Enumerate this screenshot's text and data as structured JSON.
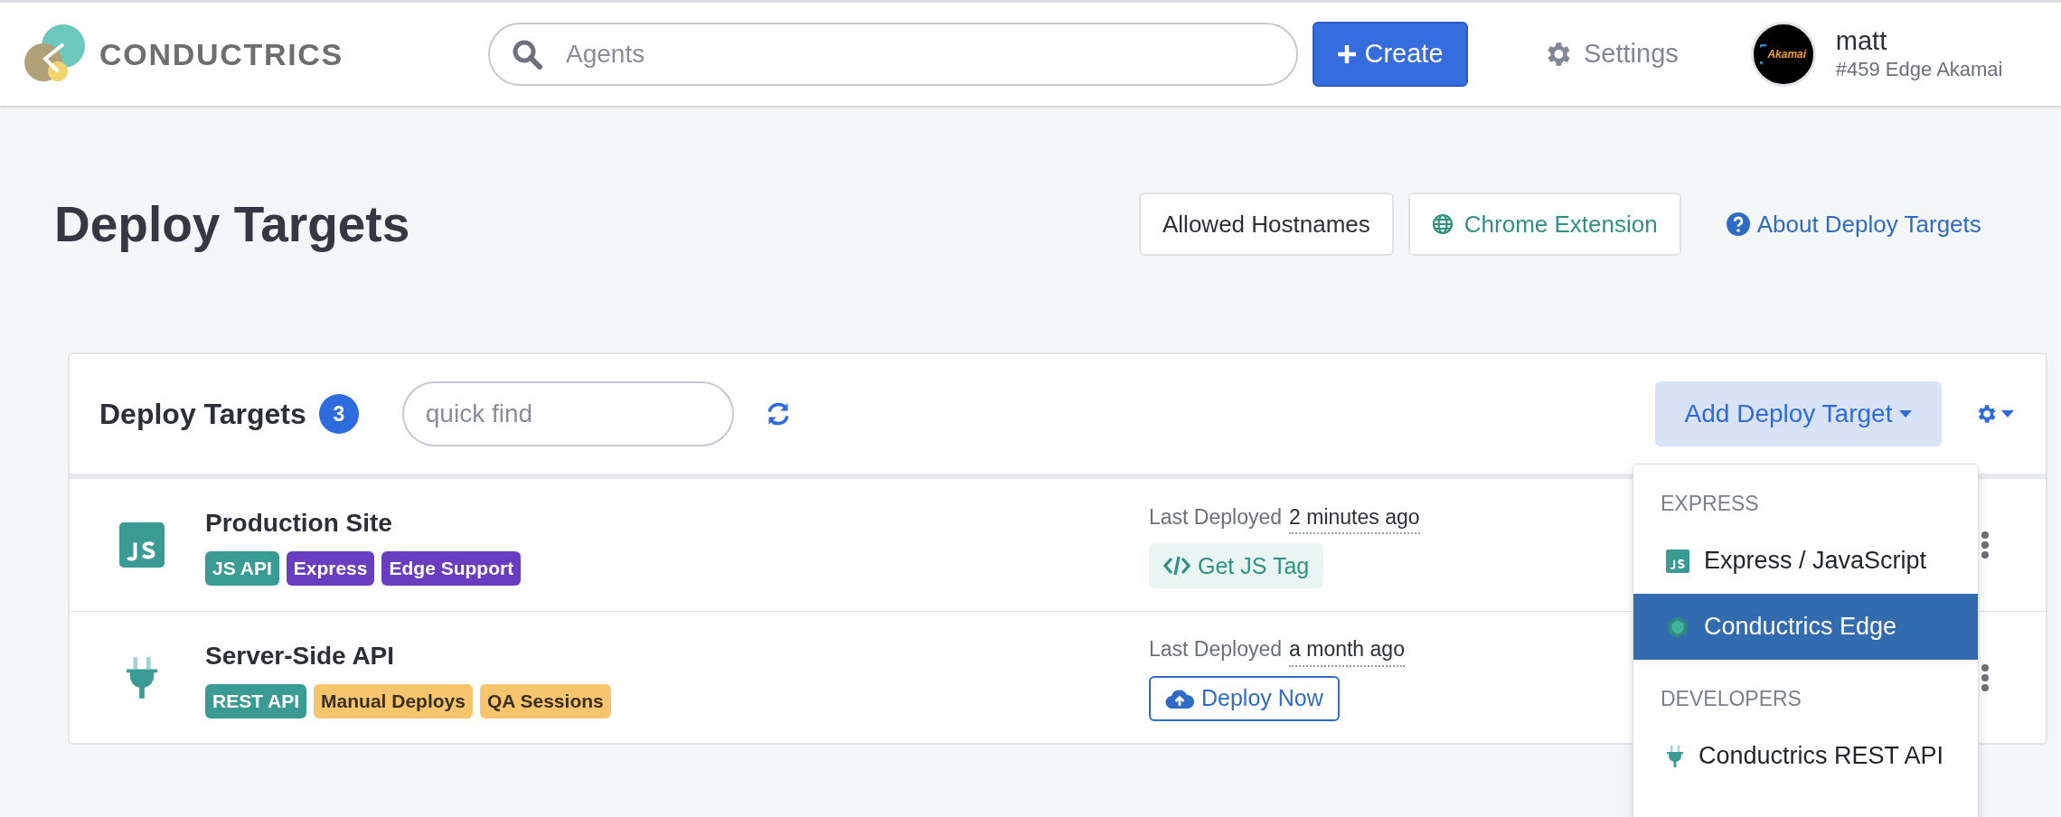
{
  "header": {
    "logo_text": "CONDUCTRICS",
    "search": {
      "placeholder": "Agents"
    },
    "create_label": "Create",
    "settings_label": "Settings",
    "user": {
      "avatar_text": "Akamai",
      "name": "matt",
      "account": "#459 Edge Akamai"
    }
  },
  "page": {
    "title": "Deploy Targets",
    "actions": [
      {
        "kind": "plain",
        "label": "Allowed Hostnames"
      },
      {
        "kind": "globe",
        "label": "Chrome Extension"
      },
      {
        "kind": "help",
        "label": "About Deploy Targets"
      }
    ]
  },
  "panel": {
    "title": "Deploy Targets",
    "count": "3",
    "quick_find": {
      "placeholder": "quick find"
    },
    "add_button": "Add Deploy Target",
    "rows": [
      {
        "kind": "js",
        "name": "Production Site",
        "tags": [
          {
            "label": "JS API",
            "color": "#3a9b94"
          },
          {
            "label": "Express",
            "color": "#6a3cbf"
          },
          {
            "label": "Edge Support",
            "color": "#6a3cbf"
          }
        ],
        "deployed_label": "Last Deployed",
        "deployed_time": "2 minutes ago",
        "action": {
          "kind": "tag",
          "label": "Get JS Tag"
        }
      },
      {
        "kind": "plug",
        "name": "Server-Side API",
        "tags": [
          {
            "label": "REST API",
            "color": "#3a9b94"
          },
          {
            "label": "Manual Deploys",
            "color": "#f8c56f"
          },
          {
            "label": "QA Sessions",
            "color": "#f8c56f"
          }
        ],
        "deployed_label": "Last Deployed",
        "deployed_time": "a month ago",
        "action": {
          "kind": "deploy",
          "label": "Deploy Now"
        }
      }
    ],
    "dropdown": [
      {
        "heading": "EXPRESS",
        "items": [
          {
            "kind": "js",
            "label": "Express / JavaScript",
            "selected": false
          },
          {
            "kind": "edge",
            "label": "Conductrics Edge",
            "selected": true
          }
        ]
      },
      {
        "heading": "DEVELOPERS",
        "items": [
          {
            "kind": "plug",
            "label": "Conductrics REST API",
            "selected": false
          }
        ]
      }
    ]
  }
}
